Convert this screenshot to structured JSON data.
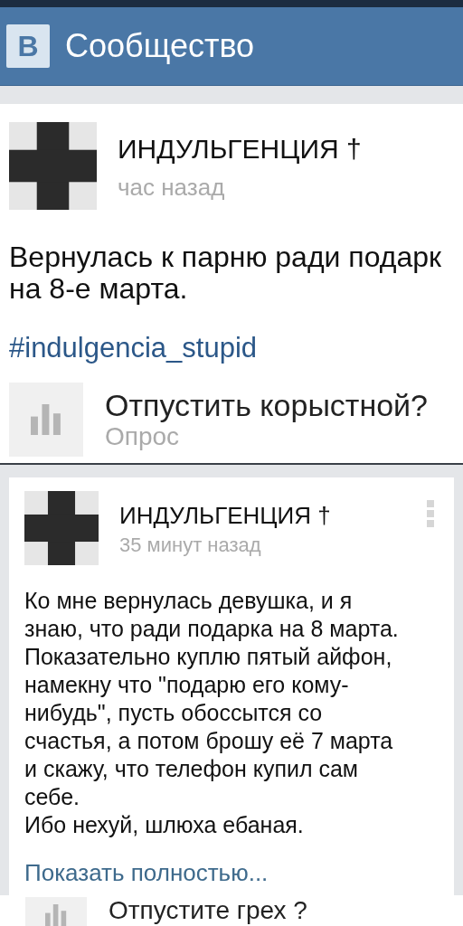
{
  "header": {
    "logo": "B",
    "title": "Сообщество"
  },
  "posts": [
    {
      "author": "ИНДУЛЬГЕНЦИЯ †",
      "time": "час назад",
      "kind": "plain",
      "menu": false,
      "lines": [
        "Вернулась к парню ради подарк",
        "на 8-е марта."
      ],
      "hashtag": "#indulgencia_stupid",
      "poll": {
        "question": "Отпустить корыстной?",
        "label": "Опрос"
      }
    },
    {
      "author": "ИНДУЛЬГЕНЦИЯ †",
      "time": "35 минут назад",
      "kind": "card",
      "menu": true,
      "lines": [
        "Ко мне вернулась девушка, и я",
        "знаю, что ради подарка на 8 марта.",
        "Показательно куплю пятый айфон,",
        "намекну что \"подарю его кому-",
        "нибудь\", пусть обоссытся со",
        "счастья, а потом брошу её 7 марта",
        "и скажу, что телефон купил сам",
        "себе.",
        "Ибо нехуй, шлюха ебаная."
      ],
      "more": "Показать полностью...",
      "poll": {
        "question": "Отпустите грех ?"
      }
    }
  ]
}
